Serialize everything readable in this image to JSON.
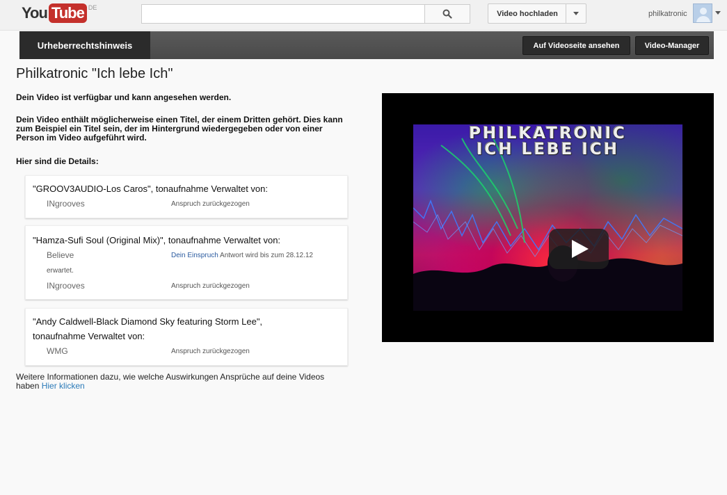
{
  "header": {
    "logo_you": "You",
    "logo_tube": "Tube",
    "logo_country": "DE",
    "search_value": "",
    "upload_label": "Video hochladen",
    "username": "philkatronic"
  },
  "toolbar": {
    "tab_label": "Urheberrechtshinweis",
    "watch_label": "Auf Videoseite ansehen",
    "manager_label": "Video-Manager"
  },
  "main": {
    "title": "Philkatronic \"Ich lebe Ich\"",
    "available_text": "Dein Video ist verfügbar und kann angesehen werden.",
    "notice_text": "Dein Video enthält möglicherweise einen Titel, der einem Dritten gehört. Dies kann zum Beispiel ein Titel sein, der im Hintergrund wiedergegeben oder von einer Person im Video aufgeführt wird.",
    "details_heading": "Hier sind die Details:",
    "claims": [
      {
        "title": "\"GROOV3AUDIO-Los Caros\", tonaufnahme Verwaltet von:",
        "owners": [
          {
            "name": "INgrooves",
            "status": "Anspruch zurückgezogen"
          }
        ]
      },
      {
        "title": "\"Hamza-Sufi Soul (Original Mix)\", tonaufnahme Verwaltet von:",
        "owners": [
          {
            "name": "Believe",
            "dispute_link": "Dein Einspruch",
            "status": " Antwort wird bis zum 28.12.12",
            "status_wrap": "erwartet."
          },
          {
            "name": "INgrooves",
            "status": "Anspruch zurückgezogen"
          }
        ]
      },
      {
        "title": "\"Andy Caldwell-Black Diamond Sky featuring Storm Lee\",",
        "title_line2": "tonaufnahme Verwaltet von:",
        "owners": [
          {
            "name": "WMG",
            "status": "Anspruch zurückgezogen"
          }
        ]
      }
    ],
    "more_info_text": "Weitere Informationen dazu, wie welche Auswirkungen Ansprüche auf deine Videos haben ",
    "more_info_link": "Hier klicken"
  },
  "video": {
    "overlay_line1": "PHILKATRONIC",
    "overlay_line2": "ICH LEBE ICH"
  },
  "icons": {
    "search": "search-icon",
    "dropdown": "chevron-down-icon",
    "avatar": "avatar-icon",
    "play": "play-icon"
  },
  "colors": {
    "brand_red": "#c4302b",
    "dark_bar": "#4a4a4a",
    "link_blue": "#2a7ab8"
  }
}
